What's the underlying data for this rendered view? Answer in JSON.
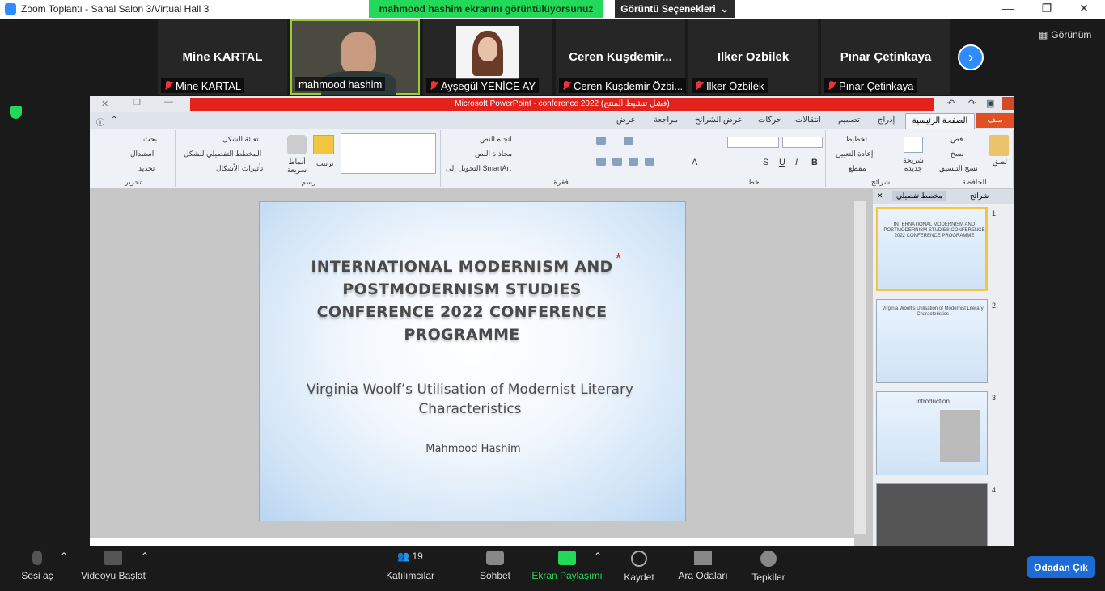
{
  "window": {
    "title": "Zoom Toplantı - Sanal Salon 3/Virtual Hall 3",
    "share_banner": "mahmood hashim  ekranını görüntülüyorsunuz",
    "view_options": "Görüntü Seçenekleri",
    "view_label": "Görünüm"
  },
  "participants": [
    {
      "big_name": "Mine KARTAL",
      "label": "Mine KARTAL",
      "muted": true
    },
    {
      "big_name": "",
      "label": "mahmood hashim",
      "muted": false,
      "video": true
    },
    {
      "big_name": "",
      "label": "Ayşegül YENİCE AY",
      "muted": true,
      "photo": true
    },
    {
      "big_name": "Ceren  Kuşdemir...",
      "label": "Ceren Kuşdemir Özbi...",
      "muted": true
    },
    {
      "big_name": "Ilker Ozbilek",
      "label": "Ilker Ozbilek",
      "muted": true
    },
    {
      "big_name": "Pınar Çetinkaya",
      "label": "Pınar Çetinkaya",
      "muted": true
    }
  ],
  "ppt": {
    "title": "Microsoft PowerPoint - conference 2022 (فشل تنشيط المنتج)",
    "tabs": {
      "file": "ملف",
      "home": "الصفحة الرئيسية",
      "others": [
        "إدراج",
        "تصميم",
        "انتقالات",
        "حركات",
        "عرض الشرائح",
        "مراجعة",
        "عرض"
      ]
    },
    "ribbon": {
      "clipboard": "الحافظة",
      "paste": "لصق",
      "cut": "قص",
      "copy": "نسخ",
      "format_painter": "نسخ التنسيق",
      "slides": "شرائح",
      "new_slide": "شريحة جديدة",
      "layout": "تخطيط",
      "reset": "إعادة التعيين",
      "section": "مقطع",
      "font": "خط",
      "paragraph": "فقرة",
      "text_direction": "اتجاه النص",
      "align_text": "محاذاة النص",
      "smartart": "التحويل إلى SmartArt",
      "drawing": "رسم",
      "arrange": "ترتيب",
      "quick_styles": "أنماط سريعة",
      "shape_fill": "تعبئة الشكل",
      "shape_outline": "المخطط التفصيلي للشكل",
      "shape_effects": "تأثيرات الأشكال",
      "editing": "تحرير",
      "find": "بحث",
      "replace": "استبدال",
      "select": "تحديد"
    },
    "panel_tabs": {
      "slides": "شرائح",
      "outline": "مخطط تفصيلي"
    },
    "slide": {
      "title": "INTERNATIONAL MODERNISM AND POSTMODERNISM STUDIES CONFERENCE 2022 CONFERENCE PROGRAMME",
      "subtitle": "Virginia Woolf’s Utilisation of Modernist Literary Characteristics",
      "author": "Mahmood Hashim"
    },
    "thumbs": [
      {
        "num": "1",
        "text": "INTERNATIONAL MODERNISM AND POSTMODERNISM STUDIES CONFERENCE 2022 CONFERENCE PROGRAMME"
      },
      {
        "num": "2",
        "text": "Virginia Woolf’s Utilisation of Modernist Literary Characteristics"
      },
      {
        "num": "3",
        "text": "Introduction"
      },
      {
        "num": "4",
        "text": ""
      }
    ]
  },
  "toolbar": {
    "mute": "Sesi aç",
    "video": "Videoyu Başlat",
    "participants_count": "19",
    "participants": "Katılımcılar",
    "chat": "Sohbet",
    "share": "Ekran Paylaşımı",
    "record": "Kaydet",
    "rooms": "Ara Odaları",
    "reactions": "Tepkiler",
    "leave": "Odadan Çık"
  },
  "colors": {
    "accent": "#2d8cff",
    "share_green": "#23d959",
    "ppt_red": "#e2221c"
  }
}
